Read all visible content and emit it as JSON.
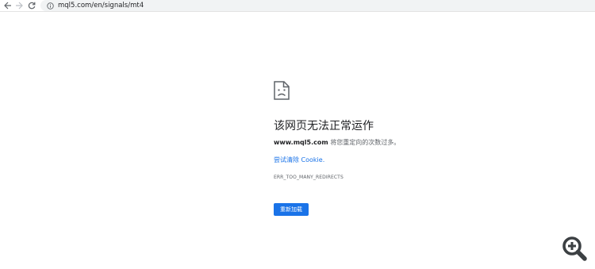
{
  "toolbar": {
    "url": "mql5.com/en/signals/mt4",
    "back_icon": "arrow-left-icon",
    "forward_icon": "arrow-right-icon",
    "reload_icon": "reload-icon",
    "info_icon": "info-icon"
  },
  "error_page": {
    "icon": "sad-document-icon",
    "heading": "该网页无法正常运作",
    "description_host": "www.mql5.com",
    "description_rest": " 将您重定向的次数过多。",
    "suggestion_prefix": "尝试清除",
    "suggestion_link": " Cookie.",
    "error_code": "ERR_TOO_MANY_REDIRECTS",
    "reload_label": "重新加载"
  },
  "overlay": {
    "zoom_icon": "zoom-in-icon"
  },
  "colors": {
    "accent": "#1a73e8",
    "text_primary": "#202124",
    "text_secondary": "#5f6368"
  }
}
